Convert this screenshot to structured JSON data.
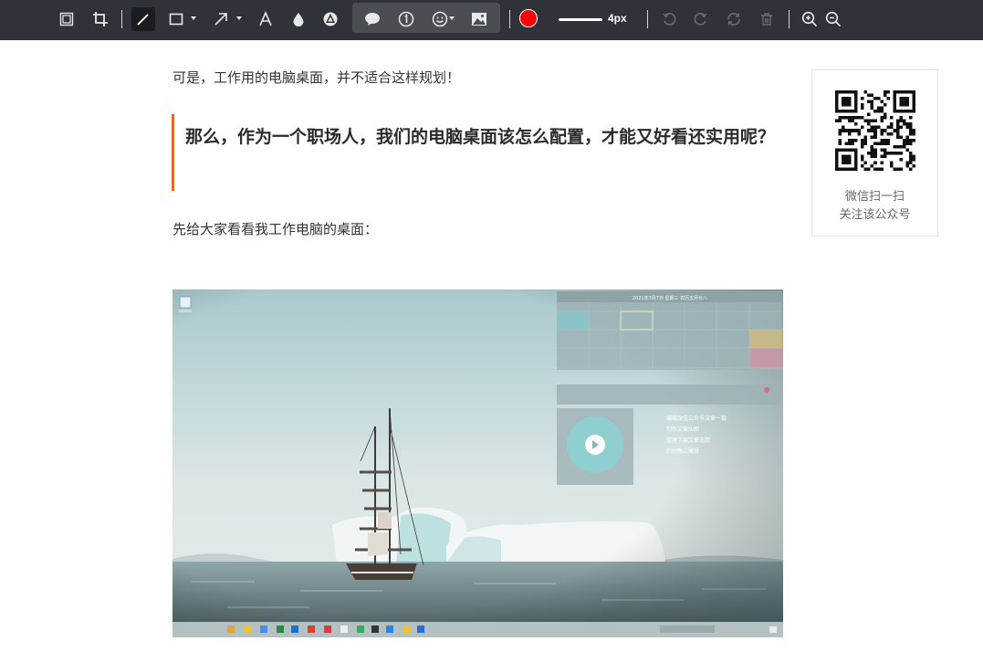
{
  "toolbar": {
    "tools": [
      {
        "name": "fit-to-window",
        "icon": "fit-screen-icon"
      },
      {
        "name": "crop",
        "icon": "crop-icon"
      },
      {
        "name": "pen",
        "icon": "pen-icon",
        "active": true
      },
      {
        "name": "rectangle",
        "icon": "rectangle-icon"
      },
      {
        "name": "arrow",
        "icon": "arrow-icon"
      },
      {
        "name": "text",
        "icon": "text-icon"
      },
      {
        "name": "blur",
        "icon": "droplet-icon"
      },
      {
        "name": "mosaic",
        "icon": "mosaic-icon"
      },
      {
        "name": "speech-bubble",
        "icon": "speech-bubble-icon"
      },
      {
        "name": "number",
        "icon": "number-circle-icon"
      },
      {
        "name": "emoji",
        "icon": "emoji-icon"
      },
      {
        "name": "image",
        "icon": "image-icon"
      },
      {
        "name": "undo",
        "icon": "undo-icon",
        "disabled": true
      },
      {
        "name": "redo",
        "icon": "redo-icon",
        "disabled": true
      },
      {
        "name": "reset",
        "icon": "reset-icon",
        "disabled": true
      },
      {
        "name": "delete",
        "icon": "trash-icon",
        "disabled": true
      },
      {
        "name": "zoom-in",
        "icon": "zoom-in-icon"
      },
      {
        "name": "zoom-out",
        "icon": "zoom-out-icon"
      }
    ],
    "color": "#ff0000",
    "stroke_width_label": "4px"
  },
  "article": {
    "paragraph1": "可是，工作用的电脑桌面，并不适合这样规划！",
    "quote": "那么，作为一个职场人，我们的电脑桌面该怎么配置，才能又好看还实用呢？",
    "paragraph2": "先给大家看看我工作电脑的桌面：",
    "accent_color": "#e36a2b"
  },
  "desktop_image": {
    "calendar_title": "2021年7月7日 星期三 农历五月廿八",
    "notes": [
      "编辑微信公众号文章一篇",
      "制作文章头图",
      "整理下周文章选题",
      "约好晚上聚餐"
    ]
  },
  "qr_card": {
    "line1": "微信扫一扫",
    "line2": "关注该公众号"
  }
}
